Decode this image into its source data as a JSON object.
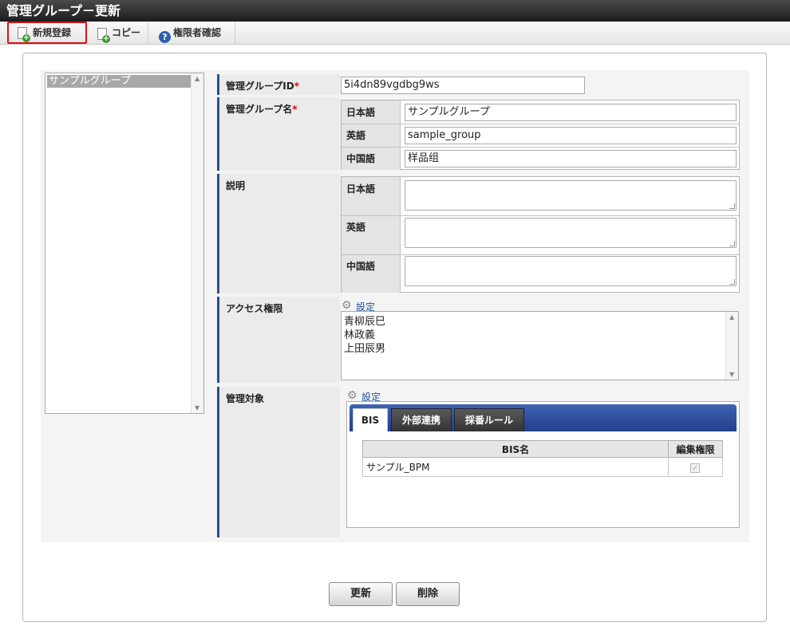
{
  "title": "管理グループ－更新",
  "toolbar": {
    "new_label": "新規登録",
    "copy_label": "コピー",
    "auth_label": "権限者確認"
  },
  "group_list": {
    "items": [
      "サンプルグループ"
    ]
  },
  "form": {
    "id": {
      "label": "管理グループID",
      "required_mark": "*",
      "value": "5i4dn89vgdbg9ws"
    },
    "name": {
      "label": "管理グループ名",
      "required_mark": "*",
      "rows": [
        {
          "lang": "日本語",
          "value": "サンプルグループ"
        },
        {
          "lang": "英語",
          "value": "sample_group"
        },
        {
          "lang": "中国語",
          "value": "样品组"
        }
      ]
    },
    "description": {
      "label": "説明",
      "rows": [
        {
          "lang": "日本語",
          "value": ""
        },
        {
          "lang": "英語",
          "value": ""
        },
        {
          "lang": "中国語",
          "value": ""
        }
      ]
    },
    "access": {
      "label": "アクセス権限",
      "setting_label": "設定",
      "users": [
        "青柳辰巳",
        "林政義",
        "上田辰男"
      ]
    },
    "target": {
      "label": "管理対象",
      "setting_label": "設定",
      "tabs": [
        "BIS",
        "外部連携",
        "採番ルール"
      ],
      "active_tab": "BIS",
      "table": {
        "columns": [
          "BIS名",
          "編集権限"
        ],
        "rows": [
          {
            "name": "サンプル_BPM",
            "edit": true
          }
        ]
      }
    }
  },
  "actions": {
    "update_label": "更新",
    "delete_label": "削除"
  }
}
